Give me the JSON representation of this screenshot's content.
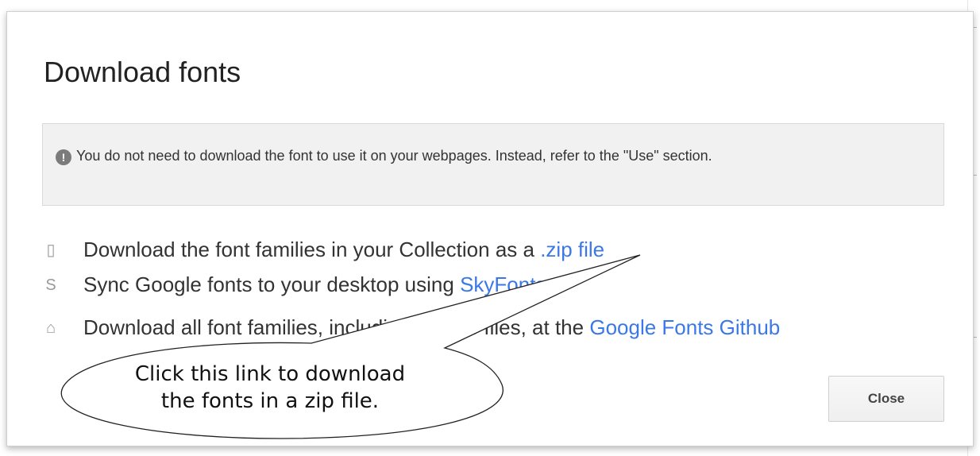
{
  "dialog": {
    "title": "Download fonts",
    "notice": {
      "icon": "alert-icon",
      "icon_glyph": "!",
      "text": "You do not need to download the font to use it on your webpages. Instead, refer to the \"Use\" section."
    },
    "options": [
      {
        "icon": "zip-file-icon",
        "icon_glyph": "▯",
        "text_before": "Download the font families in your Collection as a ",
        "link": ".zip file",
        "text_after": ""
      },
      {
        "icon": "skyfonts-icon",
        "icon_glyph": "S",
        "text_before": "Sync Google fonts to your desktop using ",
        "link": "SkyFonts",
        "text_after": ""
      },
      {
        "icon": "github-icon",
        "icon_glyph": "⌂",
        "text_before": "Download all font families, including source files, at the ",
        "link": "Google Fonts Github",
        "text_after": ""
      }
    ],
    "close_label": "Close"
  },
  "callout": {
    "lines": [
      "Click this link to download",
      "the fonts in a zip file."
    ]
  },
  "colors": {
    "link": "#3b78e7",
    "text": "#333333",
    "notice_bg": "#f1f1f1"
  }
}
